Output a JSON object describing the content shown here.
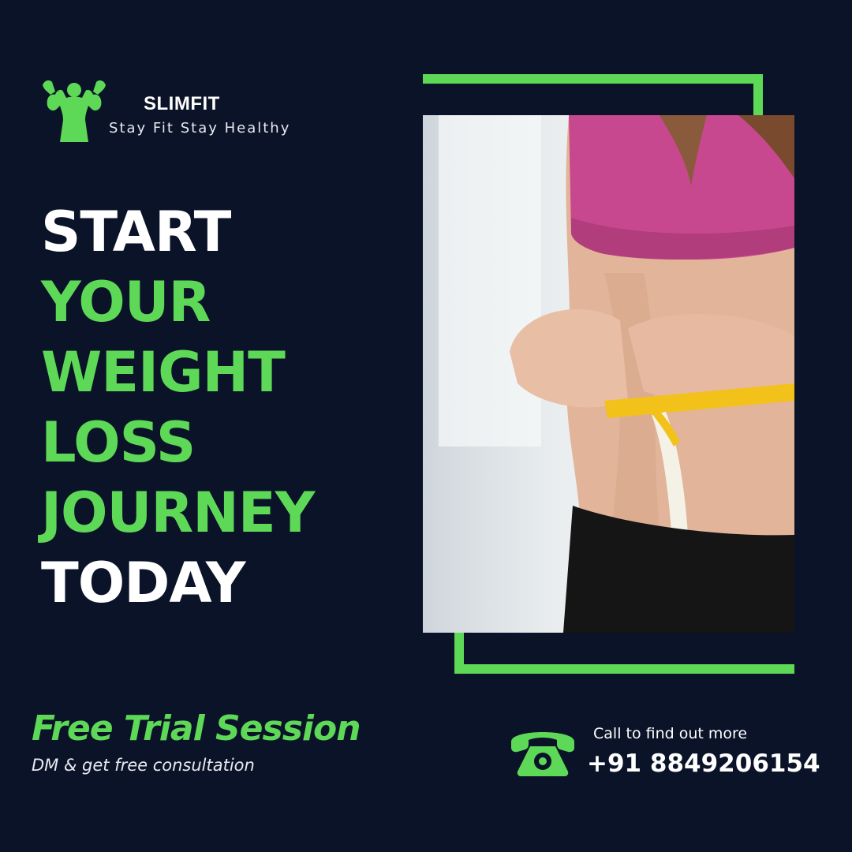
{
  "brand": {
    "name": "SLIMFIT",
    "tagline": "Stay Fit Stay Healthy",
    "logo_icon": "muscle-man-icon"
  },
  "headline": {
    "line1": "START",
    "line2": "YOUR",
    "line3": "WEIGHT",
    "line4": "LOSS",
    "line5": "JOURNEY",
    "line6": "TODAY"
  },
  "photo": {
    "subject": "woman-measuring-waist-image"
  },
  "promo": {
    "title": "Free Trial Session",
    "subtitle": "DM & get free consultation"
  },
  "contact": {
    "label": "Call to find out more",
    "phone": "+91 8849206154",
    "icon": "telephone-icon"
  },
  "colors": {
    "background": "#0b1329",
    "accent": "#5ed857",
    "text": "#ffffff"
  }
}
